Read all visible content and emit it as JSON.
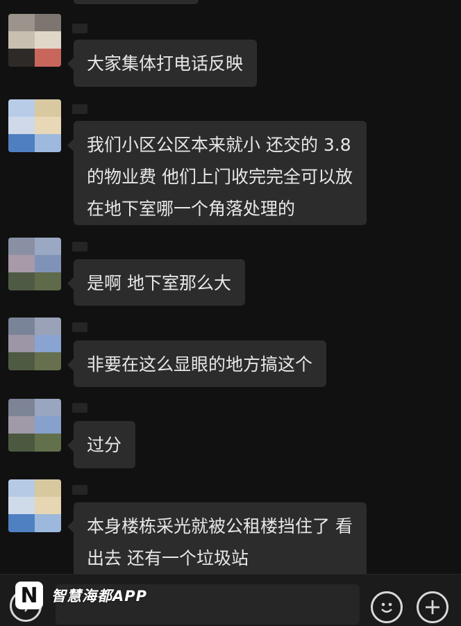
{
  "messages": [
    {
      "text": "大家集体打电话反映"
    },
    {
      "text": "我们小区公区本来就小 还交的 3.8\n的物业费 他们上门收完完全可以放\n在地下室哪一个角落处理的"
    },
    {
      "text": "是啊 地下室那么大"
    },
    {
      "text": "非要在这么显眼的地方搞这个"
    },
    {
      "text": "过分"
    },
    {
      "text": "本身楼栋采光就被公租楼挡住了 看\n出去 还有一个垃圾站"
    }
  ],
  "watermark": {
    "logo": "N",
    "text": "智慧海都APP"
  },
  "input": {
    "placeholder": ""
  },
  "icons": {
    "voice": "voice-icon",
    "emoji": "emoji-icon",
    "plus": "plus-icon"
  },
  "colors": {
    "background": "#111111",
    "bubble": "#2c2c2c",
    "text": "#e8e8e8"
  }
}
